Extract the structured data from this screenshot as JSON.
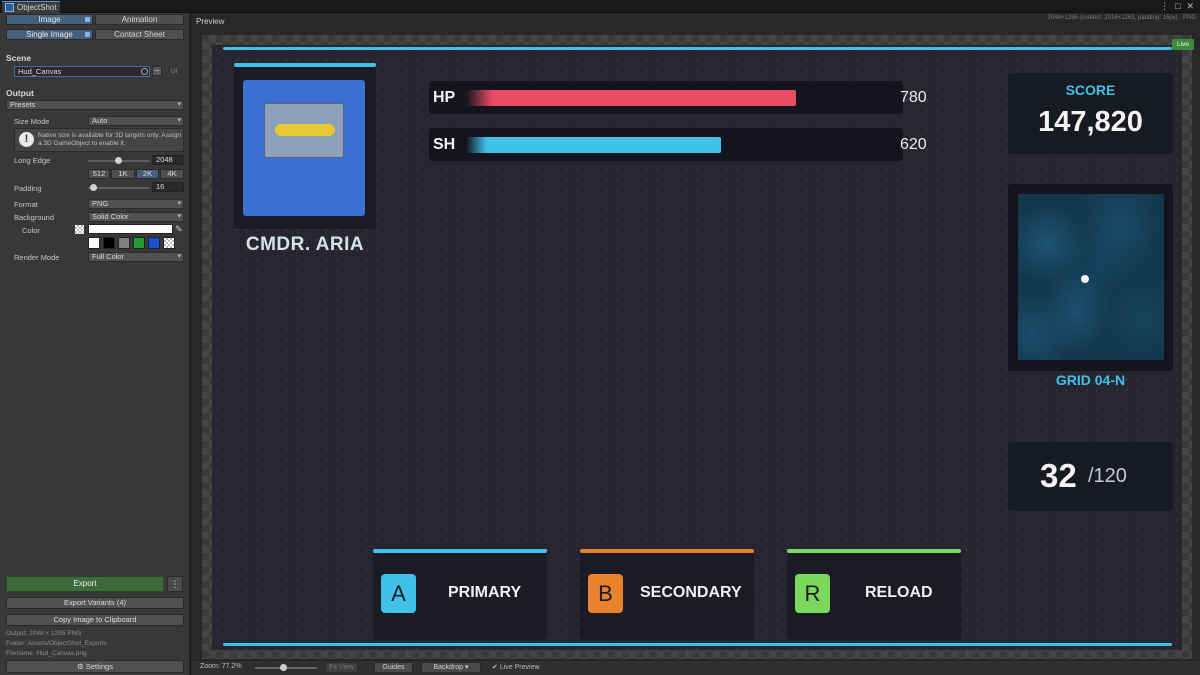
{
  "window": {
    "tab_title": "ObjectShot",
    "controls": [
      "⋮",
      "□",
      "✕"
    ]
  },
  "mode_tabs": {
    "image": "Image",
    "animation": "Animation",
    "single_image": "Single Image",
    "contact_sheet": "Contact Sheet"
  },
  "scene": {
    "header": "Scene",
    "object": "Hud_Canvas",
    "ui_tag": "UI"
  },
  "output": {
    "header": "Output",
    "presets": "Presets",
    "size_mode_label": "Size Mode",
    "size_mode_value": "Auto",
    "help_text": "Native size is available for 3D targets only. Assign a 3D GameObject to enable it.",
    "long_edge_label": "Long Edge",
    "long_edge_value": "2048",
    "size_presets": [
      "512",
      "1K",
      "2K",
      "4K"
    ],
    "padding_label": "Padding",
    "padding_value": "16",
    "format_label": "Format",
    "format_value": "PNG",
    "background_label": "Background",
    "background_value": "Solid Color",
    "color_label": "Color",
    "render_mode_label": "Render Mode",
    "render_mode_value": "Full Color",
    "swatch_colors": [
      "#ffffff",
      "#000000",
      "#808080",
      "#1fa02f",
      "#1d4fd6"
    ]
  },
  "actions": {
    "export": "Export",
    "export_more": "⋮",
    "export_variants": "Export Variants (4)",
    "copy_clipboard": "Copy Image to Clipboard",
    "info_output": "Output: 2048 × 1295 PNG",
    "info_folder": "Folder: Assets/ObjectShot_Exports",
    "info_filename": "Filename: Hud_Canvas.png",
    "settings": "Settings"
  },
  "preview": {
    "title": "Preview",
    "meta": "2048×1295 (content: 2016×1263, padding: 16px) · PNG",
    "live_badge": "Live"
  },
  "hud": {
    "character_name": "CMDR. ARIA",
    "hp": {
      "label": "HP",
      "value": "780",
      "fraction": 0.75
    },
    "sh": {
      "label": "SH",
      "value": "620",
      "fraction": 0.58
    },
    "score_label": "SCORE",
    "score_value": "147,820",
    "map_label": "GRID 04-N",
    "ammo_current": "32",
    "ammo_max": "/120",
    "abilities": [
      {
        "key": "A",
        "label": "PRIMARY",
        "color": "#41c1e8"
      },
      {
        "key": "B",
        "label": "SECONDARY",
        "color": "#e8822c"
      },
      {
        "key": "R",
        "label": "RELOAD",
        "color": "#7bd85c"
      }
    ],
    "accent_color": "#41c1e8"
  },
  "toolbar": {
    "zoom": "Zoom: 77.2%",
    "fit_view": "Fit View",
    "guides": "Guides",
    "backdrop": "Backdrop ▾",
    "live_preview": "Live Preview"
  }
}
